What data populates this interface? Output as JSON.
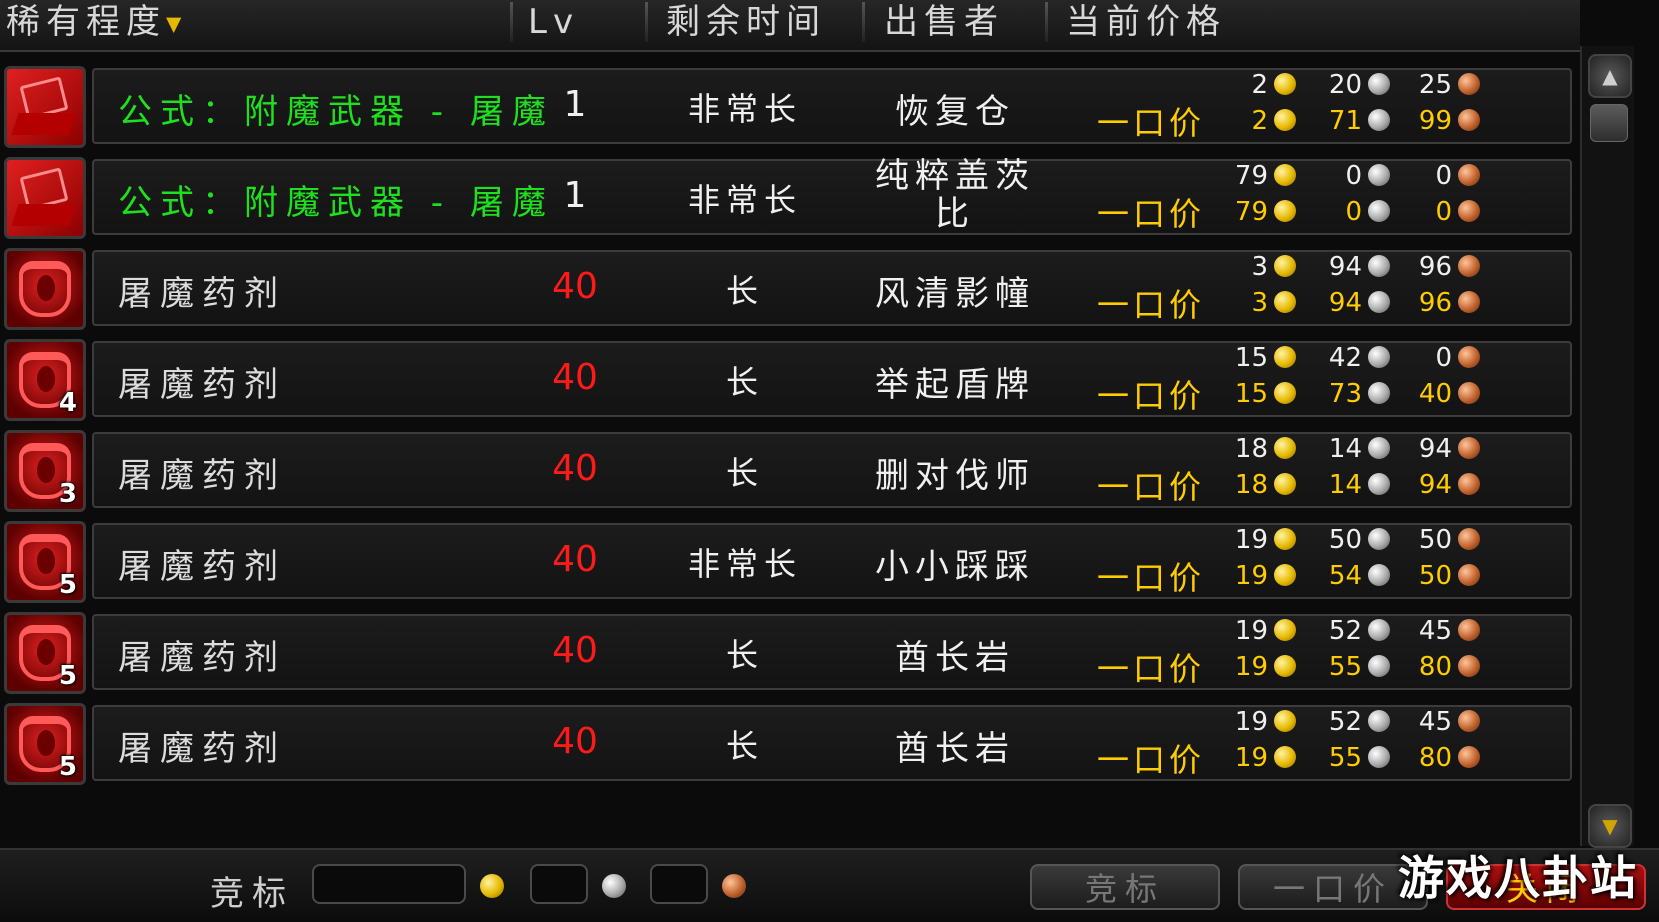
{
  "header": {
    "rarity": "稀有程度",
    "level": "Lv",
    "time_left": "剩余时间",
    "seller": "出售者",
    "current_price": "当前价格"
  },
  "rows": [
    {
      "name": "公式：附魔武器 - 屠魔",
      "level": "1",
      "time": "非常长",
      "seller": "恢复仓",
      "stack": "",
      "cur_g": "2",
      "cur_s": "20",
      "cur_c": "25",
      "bo_label": "一口价",
      "bo_g": "2",
      "bo_s": "71",
      "bo_c": "99"
    },
    {
      "name": "公式：附魔武器 - 屠魔",
      "level": "1",
      "time": "非常长",
      "seller": "纯粹盖茨比",
      "stack": "",
      "cur_g": "79",
      "cur_s": "0",
      "cur_c": "0",
      "bo_label": "一口价",
      "bo_g": "79",
      "bo_s": "0",
      "bo_c": "0"
    },
    {
      "name": "屠魔药剂",
      "level": "40",
      "time": "长",
      "seller": "风清影幢",
      "stack": "",
      "cur_g": "3",
      "cur_s": "94",
      "cur_c": "96",
      "bo_label": "一口价",
      "bo_g": "3",
      "bo_s": "94",
      "bo_c": "96"
    },
    {
      "name": "屠魔药剂",
      "level": "40",
      "time": "长",
      "seller": "举起盾牌",
      "stack": "4",
      "cur_g": "15",
      "cur_s": "42",
      "cur_c": "0",
      "bo_label": "一口价",
      "bo_g": "15",
      "bo_s": "73",
      "bo_c": "40"
    },
    {
      "name": "屠魔药剂",
      "level": "40",
      "time": "长",
      "seller": "删对伐师",
      "stack": "3",
      "cur_g": "18",
      "cur_s": "14",
      "cur_c": "94",
      "bo_label": "一口价",
      "bo_g": "18",
      "bo_s": "14",
      "bo_c": "94"
    },
    {
      "name": "屠魔药剂",
      "level": "40",
      "time": "非常长",
      "seller": "小小踩踩",
      "stack": "5",
      "cur_g": "19",
      "cur_s": "50",
      "cur_c": "50",
      "bo_label": "一口价",
      "bo_g": "19",
      "bo_s": "54",
      "bo_c": "50"
    },
    {
      "name": "屠魔药剂",
      "level": "40",
      "time": "长",
      "seller": "酋长岩",
      "stack": "5",
      "cur_g": "19",
      "cur_s": "52",
      "cur_c": "45",
      "bo_label": "一口价",
      "bo_g": "19",
      "bo_s": "55",
      "bo_c": "80"
    },
    {
      "name": "屠魔药剂",
      "level": "40",
      "time": "长",
      "seller": "酋长岩",
      "stack": "5",
      "cur_g": "19",
      "cur_s": "52",
      "cur_c": "45",
      "bo_label": "一口价",
      "bo_g": "19",
      "bo_s": "55",
      "bo_c": "80"
    }
  ],
  "bottom": {
    "bid_label": "竞标",
    "bid_button": "竞标",
    "buyout_button": "一口价",
    "close_button": "关闭"
  },
  "watermark": "游戏八卦站",
  "icons": {
    "sort": "sort-arrow-icon",
    "gold": "gold-coin-icon",
    "silver": "silver-coin-icon",
    "copper": "copper-coin-icon",
    "scroll_up": "scroll-up-icon",
    "scroll_down": "scroll-down-icon"
  },
  "colors": {
    "recipe_name": "#1fe01f",
    "potion_name": "#dcdcdc",
    "high_level": "#ff1a1a",
    "buyout": "#ffcc00"
  }
}
